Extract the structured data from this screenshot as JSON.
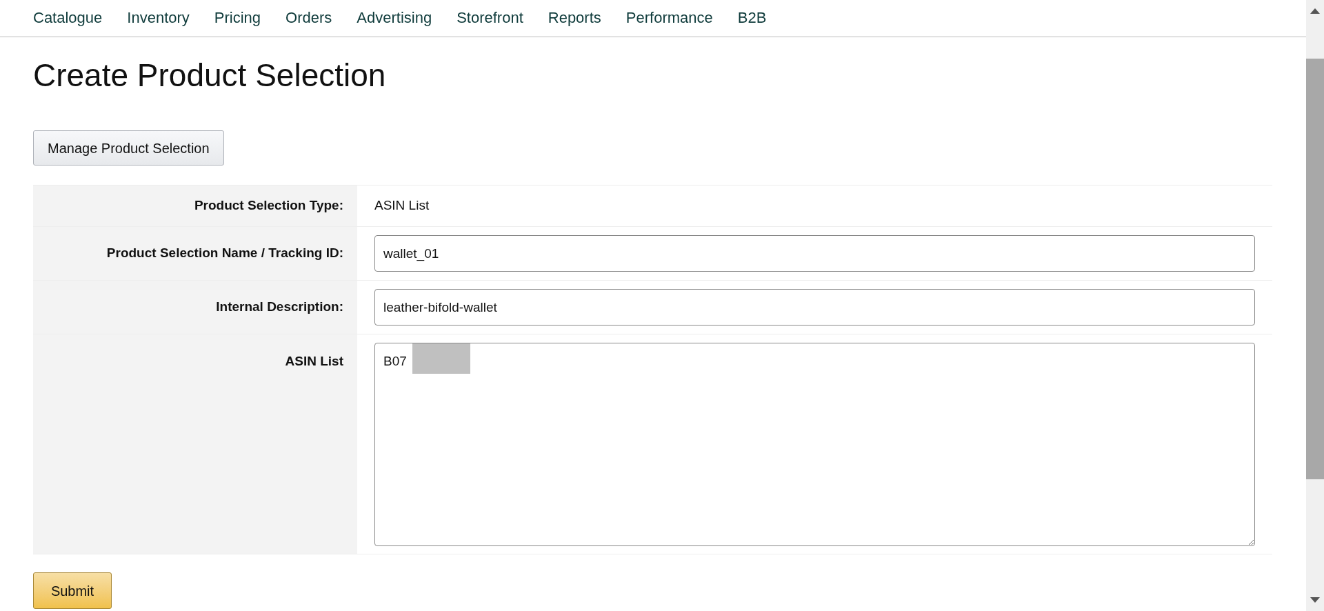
{
  "nav": {
    "items": [
      {
        "label": "Catalogue"
      },
      {
        "label": "Inventory"
      },
      {
        "label": "Pricing"
      },
      {
        "label": "Orders"
      },
      {
        "label": "Advertising"
      },
      {
        "label": "Storefront"
      },
      {
        "label": "Reports"
      },
      {
        "label": "Performance"
      },
      {
        "label": "B2B"
      }
    ]
  },
  "page_title": "Create Product Selection",
  "manage_button": "Manage Product Selection",
  "form": {
    "rows": [
      {
        "kind": "text",
        "label": "Product Selection Type:",
        "value": "ASIN List"
      },
      {
        "kind": "input",
        "label": "Product Selection Name / Tracking ID:",
        "value": "wallet_01"
      },
      {
        "kind": "input",
        "label": "Internal Description:",
        "value": "leather-bifold-wallet"
      },
      {
        "kind": "textarea",
        "label": "ASIN List",
        "value": "B07",
        "redacted": true
      }
    ]
  },
  "submit_button": "Submit"
}
